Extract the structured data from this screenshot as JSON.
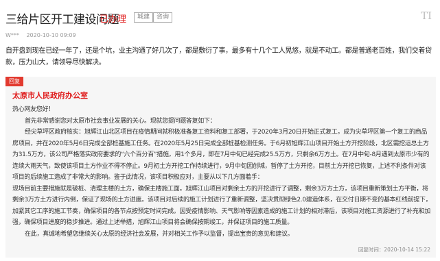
{
  "header": {
    "title": "三给片区开工建设问题",
    "status": "已办理",
    "tags": [
      "城建",
      "咨询"
    ],
    "font_icon": "TI"
  },
  "meta": {
    "author": "W***",
    "date": "2020-10-10 09:09"
  },
  "question": "自开盘到现在已经一年了，还是个坑，业主沟通了好几次了，都是敷衍了事，最多有十几个工人晃悠，就是不动工。都是普通老百姓，我们交着贷款，压力山大，请领导尽快解决。",
  "reply": {
    "badge": "回复",
    "org": "太原市人民政府办公室",
    "paragraphs": [
      "热心网友您好！",
      "首先非常感谢您对太原市社会事业发展的关心。现就您提问题答复如下：",
      "经尖草坪区政府核实：旭辉江山北区项目在疫情期间就积极准备复工资料和复工部署，于2020年3月20日开始正式复工，成为尖草坪区第一个复工的商品房项目，并在2020年5月6日完成全部桩基施工任务。在2020年5月25日完成全部桩基检测任务。于6月初旭辉江山项目开始土方开挖阶段，北区需挖运总土方为31.5万方，该公司严格落实政府要求的“六个百分百”措施，用1个多月，即在7月中旬已经完成25.5万方，只剩余6万方土。在7月中旬-8月遇到太原市少有的连续大雨天气，致使该项目土方作业不得不停止。9月初土方开挖工作持续进行，9月中旬因创城，暂停了土方开挖，目前土方开挖已恢复，上述不利条件对该项目的后续施工造成了非常大的影响。鉴于此情况，该项目积极应对，主要从以下几方面着手：",
      "现场目前主要措施就是破桩、清理主楼的土方，确保主楼施工面。旭辉江山项目对剩余土方的开挖进行了调整，剩余3万方土方，该项目重新策划土方平衡，将剩余3万方土方进行内倒，保证了现场的土方进度。该项目对后续的施工计划进行了重新调整，坚决贯彻绿色2.0建造体系，在交付日期不变的基本红线前提下，加紧其它工序的施工节奏，确保项目的各节点按预定时间完成。因受疫情影响、天气影响等因素造成的施工计划的相对滞后，该项目对施工资源进行了补充和加强，确保项目进度的稳步推进。通过上述举措，旭辉江山项目将会确保按期竣工，并保证项目的施工质量。",
      "在此，真诚地希望您继续关心太原的经济社会发展，并对相关工作予以监督，提出宝贵的意见和建议。"
    ],
    "time": "回复时间：2020-10-14 15:22"
  }
}
